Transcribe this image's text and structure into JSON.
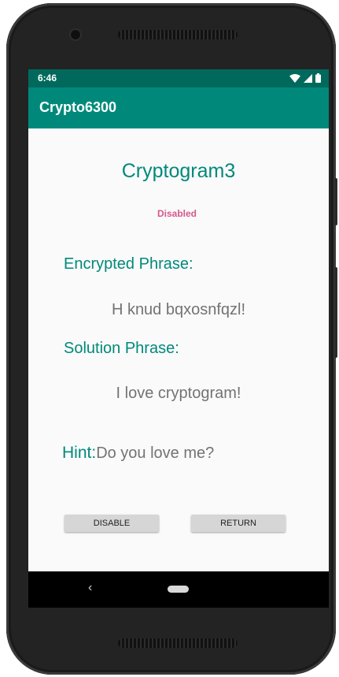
{
  "status_bar": {
    "time": "6:46",
    "icons": [
      "wifi-icon",
      "signal-icon",
      "battery-icon"
    ]
  },
  "app_bar": {
    "title": "Crypto6300"
  },
  "main": {
    "title": "Cryptogram3",
    "status": "Disabled",
    "encrypted_label": "Encrypted Phrase:",
    "encrypted_phrase": "H knud bqxosnfqzl!",
    "solution_label": "Solution Phrase:",
    "solution_phrase": "I love cryptogram!",
    "hint_label": "Hint:",
    "hint_text": "Do you love me?"
  },
  "buttons": {
    "disable_label": "DISABLE",
    "return_label": "RETURN"
  },
  "nav_bar": {
    "back_icon": "back-icon",
    "home_icon": "home-pill-icon"
  },
  "colors": {
    "status_bar": "#00695c",
    "app_bar": "#00897b",
    "accent_text": "#00897b",
    "status_label": "#d6588a",
    "body_text": "#737373"
  }
}
